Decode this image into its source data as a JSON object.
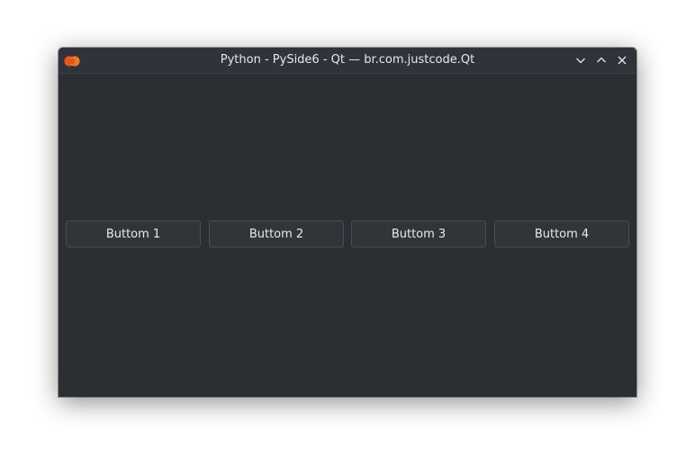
{
  "window": {
    "title": "Python - PySide6 - Qt — br.com.justcode.Qt",
    "app_icon": "qt-logo-icon",
    "controls": [
      "minimize-icon",
      "maximize-icon",
      "close-icon"
    ],
    "accent_color": "#e95420"
  },
  "main": {
    "buttons": [
      {
        "label": "Buttom 1"
      },
      {
        "label": "Buttom 2"
      },
      {
        "label": "Buttom 3"
      },
      {
        "label": "Buttom 4"
      }
    ]
  }
}
